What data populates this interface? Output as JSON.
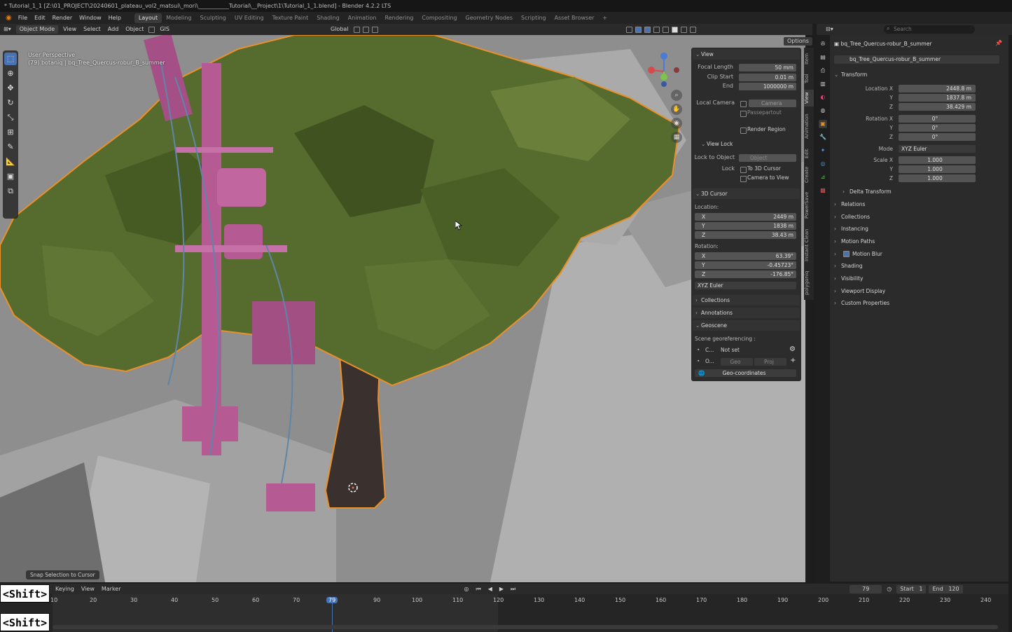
{
  "window": {
    "title": "* Tutorial_1_1 [Z:\\01_PROJECT\\20240601_plateau_vol2_matsui\\_mori\\___________Tutorial\\__Project\\1\\Tutorial_1_1.blend] - Blender 4.2.2 LTS"
  },
  "menu": {
    "items": [
      "File",
      "Edit",
      "Render",
      "Window",
      "Help"
    ]
  },
  "workspaces": [
    "Layout",
    "Modeling",
    "Sculpting",
    "UV Editing",
    "Texture Paint",
    "Shading",
    "Animation",
    "Rendering",
    "Compositing",
    "Geometry Nodes",
    "Scripting",
    "Asset Browser"
  ],
  "viewport_header": {
    "mode": "Object Mode",
    "menus": [
      "View",
      "Select",
      "Add",
      "Object",
      "GIS"
    ],
    "orientation": "Global",
    "options": "Options"
  },
  "viewport_info": {
    "line1": "User Perspective",
    "line2": "(79) botaniq | bq_Tree_Quercus-robur_B_summer"
  },
  "npanel": {
    "view_section": "View",
    "focal_length_label": "Focal Length",
    "focal_length": "50 mm",
    "clip_start_label": "Clip Start",
    "clip_start": "0.01 m",
    "end_label": "End",
    "end": "1000000 m",
    "local_camera_label": "Local Camera",
    "camera": "Camera",
    "passepartout": "Passepartout",
    "render_region": "Render Region",
    "view_lock": "View Lock",
    "lock_to_object_label": "Lock to Object",
    "object_placeholder": "Object",
    "lock_label": "Lock",
    "to_3d_cursor": "To 3D Cursor",
    "camera_to_view": "Camera to View",
    "cursor_section": "3D Cursor",
    "location_label": "Location:",
    "loc_x_label": "X",
    "loc_x": "2449 m",
    "loc_y_label": "Y",
    "loc_y": "1838 m",
    "loc_z_label": "Z",
    "loc_z": "38.43 m",
    "rotation_label": "Rotation:",
    "rot_x_label": "X",
    "rot_x": "63.39°",
    "rot_y_label": "Y",
    "rot_y": "-0.45723°",
    "rot_z_label": "Z",
    "rot_z": "-176.85°",
    "rot_mode": "XYZ Euler",
    "collections": "Collections",
    "annotations": "Annotations",
    "geoscene": "Geoscene",
    "scene_georef": "Scene georeferencing :",
    "crs_short": "C...",
    "crs_value": "Not set",
    "origin_short": "O...",
    "geo": "Geo",
    "proj": "Proj",
    "geo_coords": "Geo-coordinates"
  },
  "vtabs": [
    "Item",
    "Tool",
    "View",
    "Animation",
    "Edit",
    "Create",
    "PowerSave",
    "Instant Clean",
    "polygoniq"
  ],
  "properties": {
    "search_placeholder": "Search",
    "object_name": "bq_Tree_Quercus-robur_B_summer",
    "object_data_name": "bq_Tree_Quercus-robur_B_summer",
    "transform": "Transform",
    "location_x_label": "Location X",
    "location_x": "2448.8 m",
    "location_y_label": "Y",
    "location_y": "1837.8 m",
    "location_z_label": "Z",
    "location_z": "38.429 m",
    "rotation_x_label": "Rotation X",
    "rotation_x": "0°",
    "rotation_y_label": "Y",
    "rotation_y": "0°",
    "rotation_z_label": "Z",
    "rotation_z": "0°",
    "mode_label": "Mode",
    "mode": "XYZ Euler",
    "scale_x_label": "Scale X",
    "scale_x": "1.000",
    "scale_y_label": "Y",
    "scale_y": "1.000",
    "scale_z_label": "Z",
    "scale_z": "1.000",
    "delta_transform": "Delta Transform",
    "sections": [
      "Relations",
      "Collections",
      "Instancing",
      "Motion Paths",
      "Motion Blur",
      "Shading",
      "Visibility",
      "Viewport Display",
      "Custom Properties"
    ]
  },
  "timeline": {
    "menus": [
      "Keying",
      "View",
      "Marker"
    ],
    "current_frame": "79",
    "start_label": "Start",
    "start": "1",
    "end_label": "End",
    "end": "120",
    "ticks": [
      "10",
      "20",
      "30",
      "40",
      "50",
      "60",
      "70",
      "79",
      "90",
      "100",
      "110",
      "120",
      "130",
      "140",
      "150",
      "160",
      "170",
      "180",
      "190",
      "200",
      "210",
      "220",
      "230",
      "240"
    ]
  },
  "toast": "Snap Selection to Cursor",
  "key_overlay": {
    "top": "<Shift>",
    "bottom": "<Shift>"
  }
}
